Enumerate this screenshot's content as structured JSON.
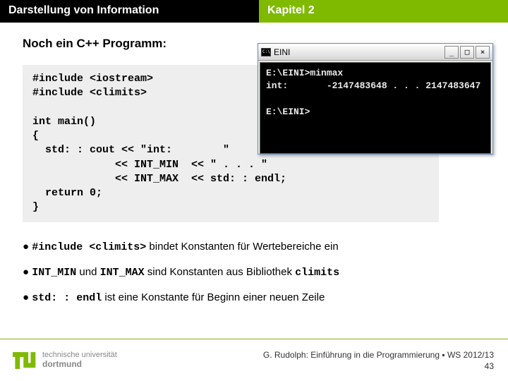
{
  "header": {
    "left": "Darstellung von Information",
    "right": "Kapitel 2"
  },
  "subtitle": "Noch ein C++ Programm:",
  "code": "#include <iostream>\n#include <climits>\n\nint main()\n{\n  std: : cout << \"int:        \"\n             << INT_MIN  << \" . . . \"\n             << INT_MAX  << std: : endl;\n  return 0;\n}",
  "bullets": {
    "b1": {
      "code": "#include <climits>",
      "text": " bindet Konstanten für Wertebereiche ein"
    },
    "b2": {
      "code1": "INT_MIN",
      "mid": " und ",
      "code2": "INT_MAX",
      "text": " sind Konstanten aus Bibliothek ",
      "code3": "climits"
    },
    "b3": {
      "code": "std: : endl",
      "text": " ist eine Konstante für Beginn einer neuen Zeile"
    }
  },
  "console": {
    "title": "EINI",
    "body": "E:\\EINI>minmax\nint:       -2147483648 . . . 2147483647\n\nE:\\EINI>"
  },
  "footer": {
    "uni": "technische universität",
    "city": "dortmund",
    "attribution": "G. Rudolph: Einführung in die Programmierung ▪ WS 2012/13",
    "page": "43"
  },
  "winbuttons": {
    "min": "_",
    "max": "□",
    "close": "×"
  }
}
